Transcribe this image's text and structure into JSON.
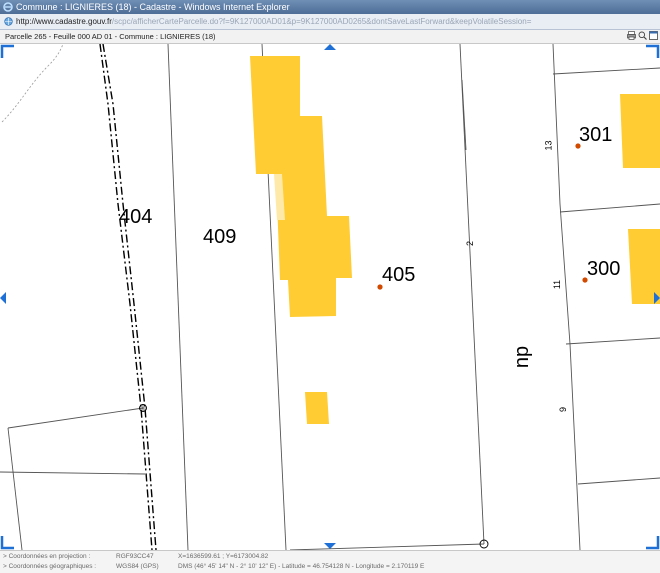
{
  "window": {
    "title": "Commune : LIGNIERES (18) - Cadastre - Windows Internet Explorer",
    "url_host": "http://www.cadastre.gouv.fr",
    "url_path": "/scpc/afficherCarteParcelle.do?f=9K127000AD01&p=9K127000AD0265&dontSaveLastForward&keepVolatileSession="
  },
  "map_header": {
    "title": "Parcelle 265 - Feuille 000 AD 01 - Commune : LIGNIERES (18)",
    "tools": [
      "print-icon",
      "zoom-icon",
      "fullscreen-icon"
    ]
  },
  "map": {
    "parcels": [
      {
        "label": "404"
      },
      {
        "label": "409"
      },
      {
        "label": "405"
      },
      {
        "label": "301"
      },
      {
        "label": "300"
      }
    ],
    "address_numbers": [
      "13",
      "11",
      "9",
      "2"
    ],
    "street_text": "du",
    "building_color": "#ffcc33",
    "parcel_line_color": "#555555",
    "point_color": "#d24a00"
  },
  "status": {
    "projection_label": "> Coordonnées en projection :",
    "projection_system": "RGF93CC47",
    "projection_coords": "X=1636599.61 ; Y=6173004.82",
    "geo_label": "> Coordonnées géographiques :",
    "geo_system": "WGS84 (GPS)",
    "geo_coords": "DMS (46° 45' 14\" N - 2° 10' 12\" E) - Latitude = 46.754128 N - Longitude = 2.170119 E"
  }
}
